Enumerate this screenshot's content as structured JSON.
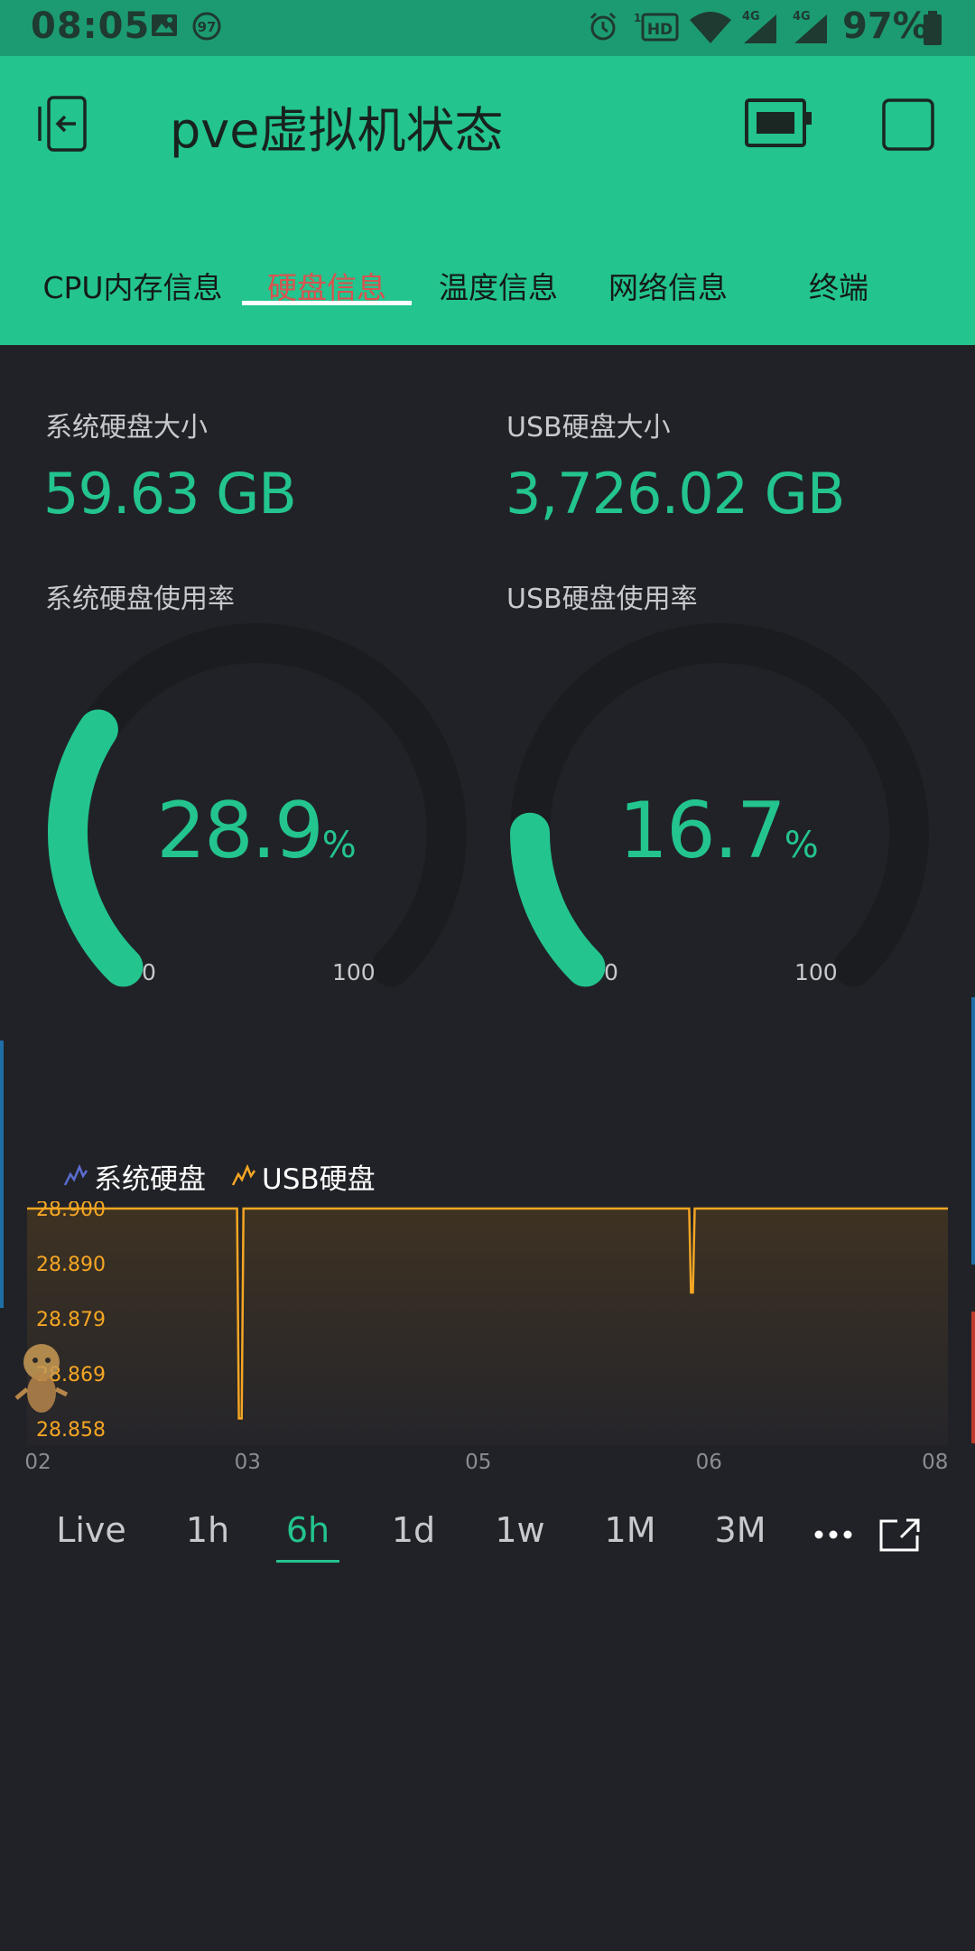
{
  "status_bar": {
    "time": "08:05",
    "notification_badge": "97",
    "hd_label": "HD",
    "network_1": "4G",
    "network_2": "4G",
    "battery": "97%"
  },
  "app_bar": {
    "title": "pve虚拟机状态",
    "tabs": [
      {
        "label": "CPU内存信息",
        "active": false
      },
      {
        "label": "硬盘信息",
        "active": true
      },
      {
        "label": "温度信息",
        "active": false
      },
      {
        "label": "网络信息",
        "active": false
      },
      {
        "label": "终端",
        "active": false
      }
    ]
  },
  "disk": {
    "system_size_label": "系统硬盘大小",
    "system_size_value": "59.63 GB",
    "usb_size_label": "USB硬盘大小",
    "usb_size_value": "3,726.02 GB",
    "system_usage_label": "系统硬盘使用率",
    "usb_usage_label": "USB硬盘使用率"
  },
  "gauges": [
    {
      "value": 28.9,
      "display": "28.9",
      "unit": "%",
      "min": "0",
      "max": "100"
    },
    {
      "value": 16.7,
      "display": "16.7",
      "unit": "%",
      "min": "0",
      "max": "100"
    }
  ],
  "colors": {
    "accent": "#23c48e",
    "background": "#212227",
    "gauge_track": "#1b1c20",
    "series_system": "#5b6dd1",
    "series_usb": "#f5a623",
    "active_tab": "#d9534f"
  },
  "chart_data": {
    "type": "line",
    "legend": [
      "系统硬盘",
      "USB硬盘"
    ],
    "y_ticks": [
      "28.900",
      "28.890",
      "28.879",
      "28.869",
      "28.858"
    ],
    "x_ticks": [
      "02",
      "03",
      "05",
      "06",
      "08"
    ],
    "ylim": [
      28.858,
      28.9
    ],
    "series": [
      {
        "name": "USB硬盘",
        "x": [
          0.0,
          0.228,
          0.23,
          0.233,
          0.235,
          0.719,
          0.721,
          0.723,
          0.725,
          1.0
        ],
        "values": [
          28.9,
          28.9,
          28.86,
          28.86,
          28.9,
          28.9,
          28.884,
          28.884,
          28.9,
          28.9
        ]
      }
    ]
  },
  "periods": [
    {
      "label": "Live",
      "active": false
    },
    {
      "label": "1h",
      "active": false
    },
    {
      "label": "6h",
      "active": true
    },
    {
      "label": "1d",
      "active": false
    },
    {
      "label": "1w",
      "active": false
    },
    {
      "label": "1M",
      "active": false
    },
    {
      "label": "3M",
      "active": false
    }
  ],
  "icons": {
    "back": "exit-icon",
    "device": "device-icon",
    "square": "square-icon",
    "more": "more-icon",
    "expand": "expand-icon"
  }
}
